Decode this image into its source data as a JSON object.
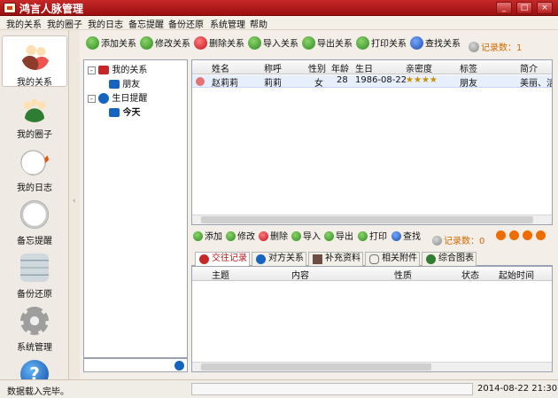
{
  "window": {
    "title": "鸿言人脉管理"
  },
  "menu": [
    "我的关系",
    "我的圈子",
    "我的日志",
    "备忘提醒",
    "备份还原",
    "系统管理",
    "帮助"
  ],
  "sidebar": [
    {
      "label": "我的关系",
      "icon": "people-icon",
      "active": true
    },
    {
      "label": "我的圈子",
      "icon": "group-icon",
      "active": false
    },
    {
      "label": "我的日志",
      "icon": "journal-icon",
      "active": false
    },
    {
      "label": "备忘提醒",
      "icon": "clock-icon",
      "active": false
    },
    {
      "label": "备份还原",
      "icon": "database-icon",
      "active": false
    },
    {
      "label": "系统管理",
      "icon": "gear-icon",
      "active": false
    },
    {
      "label": "",
      "icon": "help-icon",
      "active": false
    }
  ],
  "toolbar": {
    "buttons": [
      "添加关系",
      "修改关系",
      "删除关系",
      "导入关系",
      "导出关系",
      "打印关系",
      "查找关系"
    ],
    "record_count_label": "记录数：1"
  },
  "tree": {
    "root1": "我的关系",
    "child1": "朋友",
    "root2": "生日提醒",
    "child2": "今天"
  },
  "grid": {
    "columns": [
      "姓名",
      "称呼",
      "性别",
      "年龄",
      "生日",
      "亲密度",
      "标签",
      "简介"
    ],
    "rows": [
      {
        "name": "赵莉莉",
        "call": "莉莉",
        "gender": "女",
        "age": "28",
        "birthday": "1986-08-22",
        "intimacy": 4,
        "tag": "朋友",
        "summary": "美丽、洁"
      }
    ]
  },
  "sub_toolbar": {
    "buttons": [
      "添加",
      "修改",
      "删除",
      "导入",
      "导出",
      "打印",
      "查找"
    ],
    "record_count_label": "记录数：0"
  },
  "tabs": [
    "交往记录",
    "对方关系",
    "补充资料",
    "相关附件",
    "综合图表"
  ],
  "detail": {
    "columns": [
      "主题",
      "内容",
      "性质",
      "状态",
      "起始时间"
    ]
  },
  "status": {
    "message": "数据载入完毕。",
    "datetime": "2014-08-22 21:30"
  },
  "colors": {
    "title_red": "#b71c1c",
    "accent_orange": "#d46a00",
    "selection": "#e7eefc"
  }
}
